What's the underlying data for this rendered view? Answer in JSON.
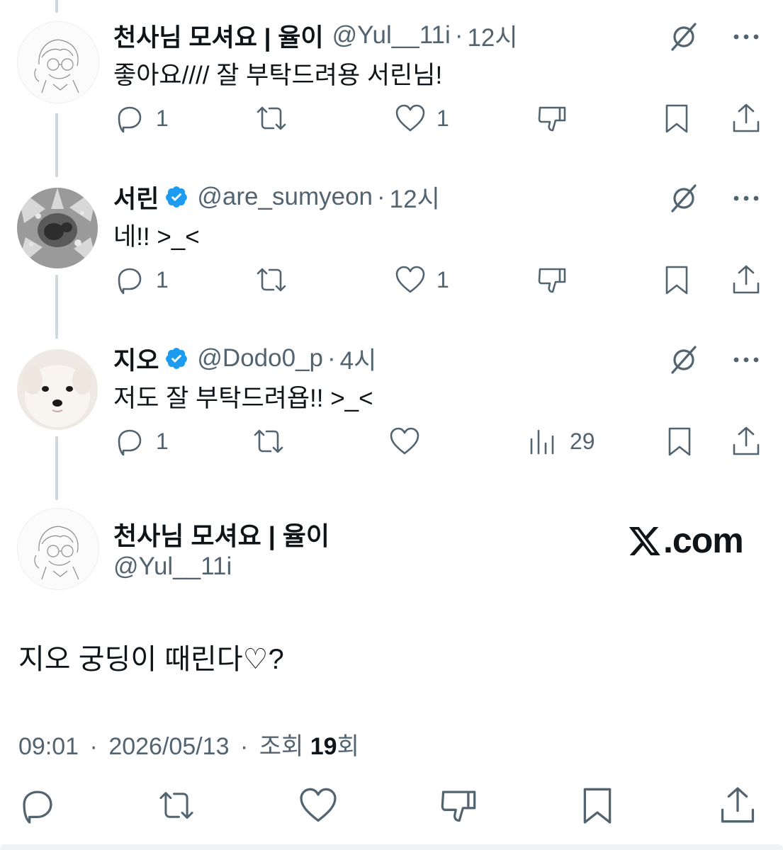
{
  "colors": {
    "text": "#0f1419",
    "muted": "#536471",
    "verified": "#1d9bf0",
    "thread_line": "#cfd9de"
  },
  "replies": [
    {
      "name": "천사님 모셔요 | 율이",
      "verified": false,
      "handle": "@Yul__11i",
      "separator": "·",
      "time": "12시",
      "text": "좋아요//// 잘 부탁드려용 서린님!",
      "reply_count": "1",
      "like_count": "1",
      "avatar_icon": "sketch-avatar-icon"
    },
    {
      "name": "서린",
      "verified": true,
      "handle": "@are_sumyeon",
      "separator": "·",
      "time": "12시",
      "text": "네!! >_<",
      "reply_count": "1",
      "like_count": "1",
      "avatar_icon": "grayscale-texture-avatar-icon"
    },
    {
      "name": "지오",
      "verified": true,
      "handle": "@Dodo0_p",
      "separator": "·",
      "time": "4시",
      "text": "저도 잘 부탁드려욥!! >_<",
      "reply_count": "1",
      "like_count": "",
      "view_count": "29",
      "avatar_icon": "puppy-avatar-icon"
    }
  ],
  "main_tweet": {
    "name": "천사님 모셔요 | 율이",
    "handle": "@Yul__11i",
    "brand": ".com",
    "text": "지오 궁딩이 때린다♡?",
    "time": "09:01",
    "separator": "·",
    "date": "2026/05/13",
    "views_label": "조회",
    "views_count": "19",
    "views_suffix": "회"
  }
}
